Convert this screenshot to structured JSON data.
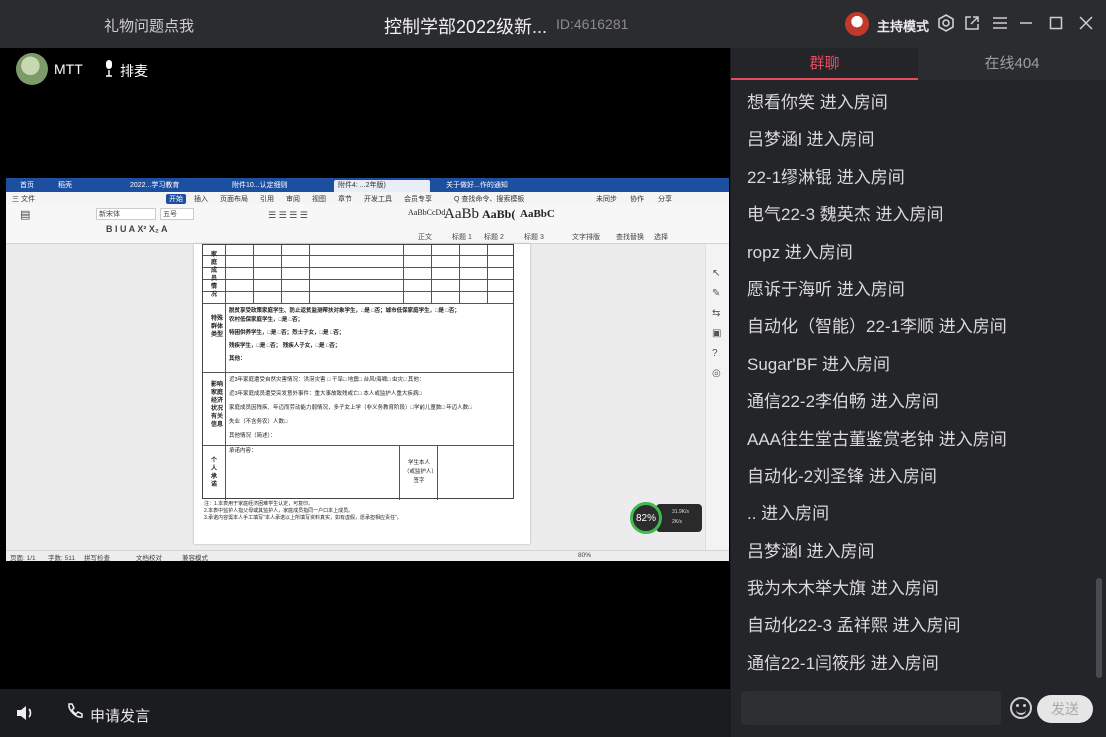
{
  "titlebar": {
    "gift_link": "礼物问题点我",
    "room_title": "控制学部2022级新...",
    "room_id": "ID:4616281",
    "host_mode": "主持模式"
  },
  "stage": {
    "user_name": "MTT",
    "queue_label": "排麦"
  },
  "shared_screen": {
    "tabs": [
      "首页",
      "稻壳",
      "2022...学习教育",
      "附件10...认定细则",
      "附件4: ...2年版)",
      "关于做好...作的通知"
    ],
    "menu": [
      "三 文件",
      "开始",
      "插入",
      "页面布局",
      "引用",
      "审阅",
      "视图",
      "章节",
      "开发工具",
      "会员专享",
      "Q 查找命令、搜索模板",
      "未同步",
      "协作",
      "分享"
    ],
    "ribbon": {
      "font_name": "新宋体",
      "font_size": "五号",
      "styles": [
        "AaBbCcDd",
        "AaBb",
        "AaBb(",
        "AaBbC"
      ],
      "style_names": [
        "正文",
        "标题 1",
        "标题 2",
        "标题 3"
      ],
      "tools": [
        "文字排版",
        "查找替换",
        "选择"
      ]
    },
    "doc": {
      "section_special": "特殊群体类型",
      "row1": "脱贫享受政策家庭学生、防止返贫监测帮扶对象学生，□是 □否；城市低保家庭学生，□是 □否；",
      "row1b": "农村低保家庭学生，□是 □否；",
      "row2": "特困供养学生，□是 □否；烈士子女，□是 □否；",
      "row3": "残疾学生，□是 □否；  残疾人子女，□是 □否；",
      "row4": "其他：",
      "section_econ": "影响家庭经济状况有关信息",
      "econ1": "近3年家庭遭受自然灾害情况：洪涝灾害 □  干旱□  地震□  台风/海啸□  虫灾□  其他：",
      "econ2": "近3年家庭成员遭受突发意外事件：重大事故致残或亡□  本人或监护人重大疾病□",
      "econ3": "家庭成员因残疾、年迈而劳动能力弱情况，多子女上学（非义务教育阶段）□学前儿童数□  年迈人数□",
      "econ4": "失业（不含务农）人数□",
      "econ5": "其他情况（简述）：",
      "section_promise": "个人承诺",
      "promise_label": "承诺内容：",
      "sign_label": "学生本人（或监护人）签字",
      "notes": [
        "注：1.本表用于家庭经济困难学生认定，可复印。",
        "2.本表中监护人指父母或其监护人，家庭成员指同一户口本上成员。",
        "3.承诺内容需本人手工填写\"本人承诺以上所填写资料真实，如有虚假，愿承担相应责任\"。"
      ]
    },
    "status": {
      "page": "页面: 1/1",
      "words": "字数: 511",
      "spell": "拼写检查",
      "proof": "文档校对",
      "compat": "兼容模式",
      "zoom": "80%"
    },
    "gauge_value": "82%",
    "gauge_up": "31.9K/s",
    "gauge_down": "2K/s"
  },
  "bottombar": {
    "apply_speak": "申请发言"
  },
  "panel": {
    "tab_group_chat": "群聊",
    "tab_online": "在线404",
    "messages": [
      "想看你笑 进入房间",
      "吕梦涵l 进入房间",
      "22-1缪淋锟 进入房间",
      "电气22-3 魏英杰 进入房间",
      "ropz 进入房间",
      "愿诉于海听 进入房间",
      "自动化（智能）22-1李顺 进入房间",
      "Sugar'BF 进入房间",
      "通信22-2李伯畅 进入房间",
      "AAA往生堂古董鉴赏老钟 进入房间",
      "自动化-2刘圣锋 进入房间",
      ".. 进入房间",
      "吕梦涵l 进入房间",
      "我为木木举大旗 进入房间",
      "自动化22-3 孟祥熙 进入房间",
      "通信22-1闫筱彤 进入房间"
    ],
    "send_label": "发送"
  }
}
